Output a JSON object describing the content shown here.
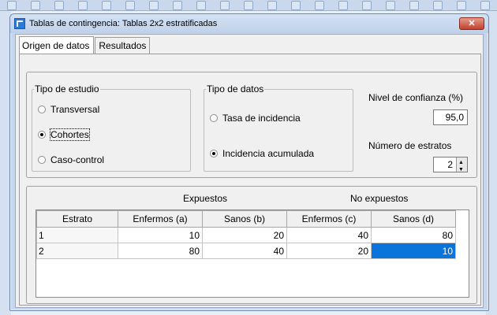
{
  "window": {
    "title": "Tablas de contingencia: Tablas 2x2 estratificadas",
    "close_label": "✕"
  },
  "tabs": [
    {
      "label": "Origen de datos",
      "active": true
    },
    {
      "label": "Resultados",
      "active": false
    }
  ],
  "study_type": {
    "legend": "Tipo de estudio",
    "options": [
      {
        "label": "Transversal",
        "checked": false
      },
      {
        "label": "Cohortes",
        "checked": true
      },
      {
        "label": "Caso-control",
        "checked": false
      }
    ]
  },
  "data_type": {
    "legend": "Tipo de datos",
    "options": [
      {
        "label": "Tasa de incidencia",
        "checked": false
      },
      {
        "label": "Incidencia acumulada",
        "checked": true
      }
    ]
  },
  "confidence": {
    "label": "Nivel de confianza (%)",
    "value": "95,0"
  },
  "strata": {
    "label": "Número de estratos",
    "value": "2"
  },
  "table": {
    "group_headers": [
      "Expuestos",
      "No expuestos"
    ],
    "columns": [
      "Estrato",
      "Enfermos (a)",
      "Sanos (b)",
      "Enfermos (c)",
      "Sanos (d)"
    ],
    "rows": [
      [
        "1",
        "10",
        "20",
        "40",
        "80"
      ],
      [
        "2",
        "80",
        "40",
        "20",
        "10"
      ]
    ],
    "selected_cell": {
      "row": 1,
      "col": 4
    },
    "selection_color": "#0a74da"
  }
}
